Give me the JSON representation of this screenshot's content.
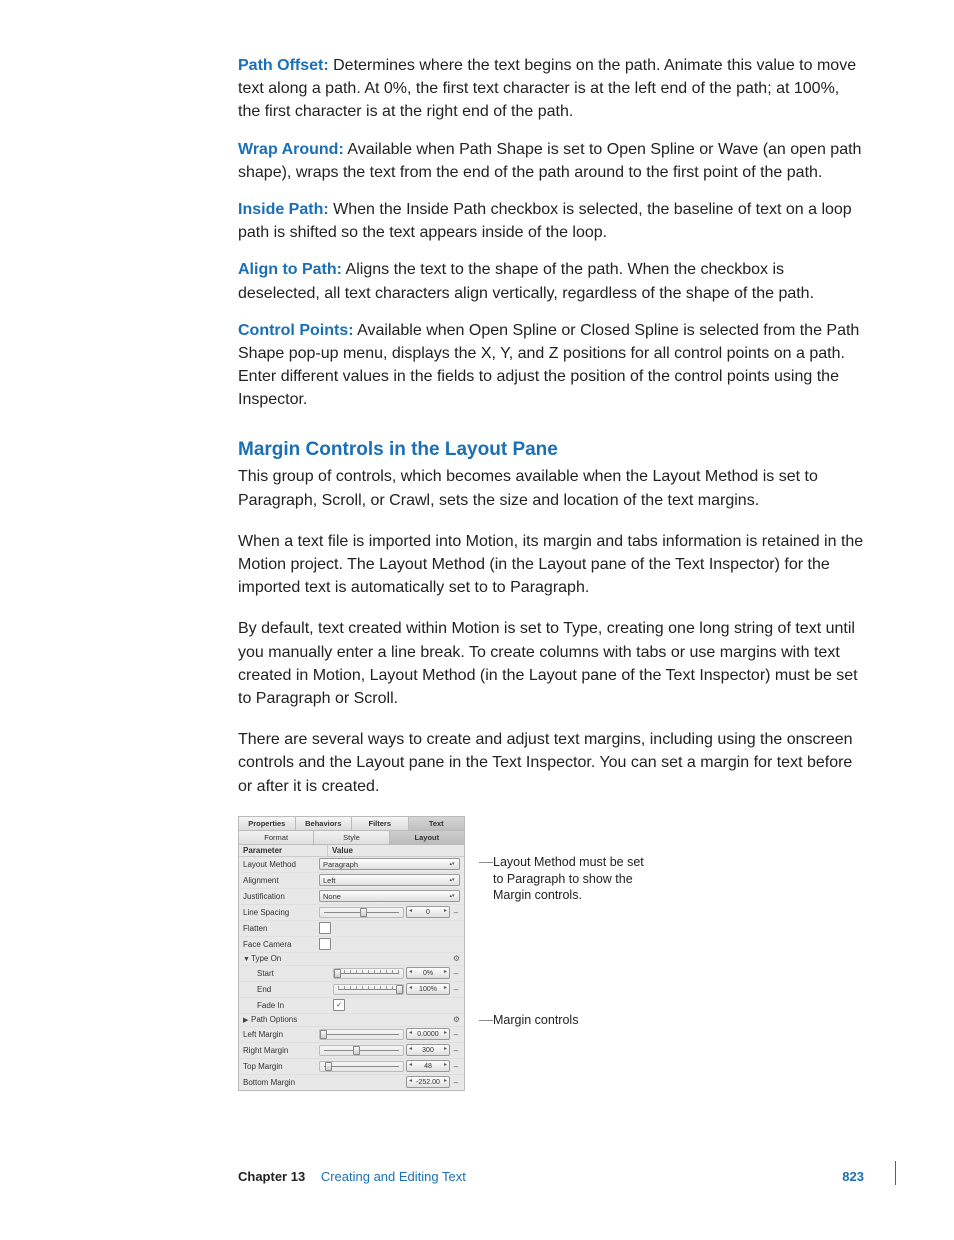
{
  "definitions": [
    {
      "label": "Path Offset:",
      "text": "Determines where the text begins on the path. Animate this value to move text along a path. At 0%, the first text character is at the left end of the path; at 100%, the first character is at the right end of the path."
    },
    {
      "label": "Wrap Around:",
      "text": "Available when Path Shape is set to Open Spline or Wave (an open path shape), wraps the text from the end of the path around to the first point of the path."
    },
    {
      "label": "Inside Path:",
      "text": "When the Inside Path checkbox is selected, the baseline of text on a loop path is shifted so the text appears inside of the loop."
    },
    {
      "label": "Align to Path:",
      "text": "Aligns the text to the shape of the path. When the checkbox is deselected, all text characters align vertically, regardless of the shape of the path."
    },
    {
      "label": "Control Points:",
      "text": "Available when Open Spline or Closed Spline is selected from the Path Shape pop-up menu, displays the X, Y, and Z positions for all control points on a path. Enter different values in the fields to adjust the position of the control points using the Inspector."
    }
  ],
  "heading": "Margin Controls in the Layout Pane",
  "paragraphs": [
    "This group of controls, which becomes available when the Layout Method is set to Paragraph, Scroll, or Crawl, sets the size and location of the text margins.",
    "When a text file is imported into Motion, its margin and tabs information is retained in the Motion project. The Layout Method (in the Layout pane of the Text Inspector) for the imported text is automatically set to to Paragraph.",
    "By default, text created within Motion is set to Type, creating one long string of text until you manually enter a line break. To create columns with tabs or use margins with text created in Motion, Layout Method (in the Layout pane of the Text Inspector) must be set to Paragraph or Scroll.",
    "There are several ways to create and adjust text margins, including using the onscreen controls and the Layout pane in the Text Inspector. You can set a margin for text before or after it is created."
  ],
  "inspector": {
    "topTabs": [
      "Properties",
      "Behaviors",
      "Filters",
      "Text"
    ],
    "subTabs": [
      "Format",
      "Style",
      "Layout"
    ],
    "headerParam": "Parameter",
    "headerValue": "Value",
    "layoutMethod": {
      "label": "Layout Method",
      "value": "Paragraph"
    },
    "alignment": {
      "label": "Alignment",
      "value": "Left"
    },
    "justification": {
      "label": "Justification",
      "value": "None"
    },
    "lineSpacing": {
      "label": "Line Spacing",
      "value": "0"
    },
    "flatten": {
      "label": "Flatten"
    },
    "faceCamera": {
      "label": "Face Camera"
    },
    "typeOn": {
      "label": "Type On"
    },
    "start": {
      "label": "Start",
      "value": "0%"
    },
    "end": {
      "label": "End",
      "value": "100%"
    },
    "fadeIn": {
      "label": "Fade In"
    },
    "pathOptions": {
      "label": "Path Options"
    },
    "leftMargin": {
      "label": "Left Margin",
      "value": "0.0000"
    },
    "rightMargin": {
      "label": "Right Margin",
      "value": "300"
    },
    "topMargin": {
      "label": "Top Margin",
      "value": "48"
    },
    "bottomMargin": {
      "label": "Bottom Margin",
      "value": "-252.00"
    }
  },
  "callouts": {
    "layoutMethod": "Layout Method must be set to Paragraph to show the Margin controls.",
    "marginControls": "Margin controls"
  },
  "footer": {
    "chapter": "Chapter 13",
    "title": "Creating and Editing Text",
    "page": "823"
  }
}
